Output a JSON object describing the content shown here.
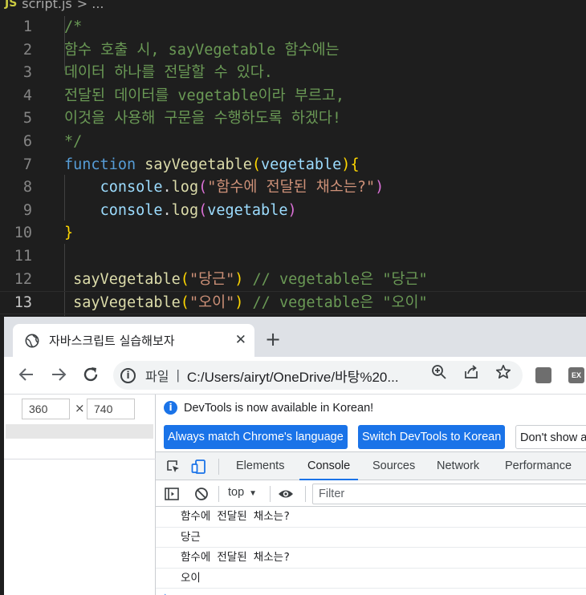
{
  "editor": {
    "breadcrumb": {
      "lang_badge": "JS",
      "file": "script.js",
      "rest": "> ..."
    },
    "lines": [
      {
        "n": "1",
        "tokens": [
          {
            "t": "/*",
            "c": "c-com"
          }
        ]
      },
      {
        "n": "2",
        "tokens": [
          {
            "t": "함수 호출 시, sayVegetable 함수에는",
            "c": "c-com"
          }
        ]
      },
      {
        "n": "3",
        "tokens": [
          {
            "t": "데이터 하나를 전달할 수 있다.",
            "c": "c-com"
          }
        ]
      },
      {
        "n": "4",
        "tokens": [
          {
            "t": "전달된 데이터를 vegetable이라 부르고,",
            "c": "c-com"
          }
        ]
      },
      {
        "n": "5",
        "tokens": [
          {
            "t": "이것을 사용해 구문을 수행하도록 하겠다!",
            "c": "c-com"
          }
        ]
      },
      {
        "n": "6",
        "tokens": [
          {
            "t": "*/",
            "c": "c-com"
          }
        ]
      },
      {
        "n": "7",
        "tokens": [
          {
            "t": "function",
            "c": "c-kw"
          },
          {
            "t": " ",
            "c": "c-txt"
          },
          {
            "t": "sayVegetable",
            "c": "c-fn"
          },
          {
            "t": "(",
            "c": "c-p1"
          },
          {
            "t": "vegetable",
            "c": "c-var"
          },
          {
            "t": ")",
            "c": "c-p1"
          },
          {
            "t": "{",
            "c": "c-p1"
          }
        ]
      },
      {
        "n": "8",
        "tokens": [
          {
            "t": "    ",
            "c": "c-txt"
          },
          {
            "t": "console",
            "c": "c-var"
          },
          {
            "t": ".",
            "c": "c-txt"
          },
          {
            "t": "log",
            "c": "c-fn"
          },
          {
            "t": "(",
            "c": "c-p2"
          },
          {
            "t": "\"함수에 전달된 채소는?\"",
            "c": "c-str"
          },
          {
            "t": ")",
            "c": "c-p2"
          }
        ]
      },
      {
        "n": "9",
        "tokens": [
          {
            "t": "    ",
            "c": "c-txt"
          },
          {
            "t": "console",
            "c": "c-var"
          },
          {
            "t": ".",
            "c": "c-txt"
          },
          {
            "t": "log",
            "c": "c-fn"
          },
          {
            "t": "(",
            "c": "c-p2"
          },
          {
            "t": "vegetable",
            "c": "c-var"
          },
          {
            "t": ")",
            "c": "c-p2"
          }
        ]
      },
      {
        "n": "10",
        "tokens": [
          {
            "t": "}",
            "c": "c-p1"
          }
        ]
      },
      {
        "n": "11",
        "tokens": []
      },
      {
        "n": "12",
        "tokens": [
          {
            "t": " sayVegetable",
            "c": "c-fn"
          },
          {
            "t": "(",
            "c": "c-p1"
          },
          {
            "t": "\"당근\"",
            "c": "c-str"
          },
          {
            "t": ")",
            "c": "c-p1"
          },
          {
            "t": " // vegetable은 \"당근\"",
            "c": "c-com"
          }
        ]
      },
      {
        "n": "13",
        "tokens": [
          {
            "t": " sayVegetable",
            "c": "c-fn"
          },
          {
            "t": "(",
            "c": "c-p1"
          },
          {
            "t": "\"오이\"",
            "c": "c-str"
          },
          {
            "t": ")",
            "c": "c-p1"
          },
          {
            "t": " // vegetable은 \"오이\"",
            "c": "c-com"
          }
        ],
        "active": true
      }
    ]
  },
  "browser": {
    "tab_title": "자바스크립트 실습해보자",
    "tab_close": "✕",
    "new_tab": "+",
    "omnibox": {
      "scheme_label": "파일",
      "separator": "|",
      "url": "C:/Users/airyt/OneDrive/바탕%20..."
    },
    "ext_badge": "EX"
  },
  "device_toolbar": {
    "width": "360",
    "height": "740",
    "times": "×"
  },
  "devtools": {
    "infobar": {
      "message": "DevTools is now available in Korean!",
      "btn_match": "Always match Chrome's language",
      "btn_switch": "Switch DevTools to Korean",
      "btn_dont": "Don't show a"
    },
    "tabs": [
      "Elements",
      "Console",
      "Sources",
      "Network",
      "Performance"
    ],
    "active_tab": "Console",
    "console_bar": {
      "context": "top",
      "filter_placeholder": "Filter"
    },
    "logs": [
      "함수에 전달된 채소는?",
      "당근",
      "함수에 전달된 채소는?",
      "오이"
    ]
  }
}
